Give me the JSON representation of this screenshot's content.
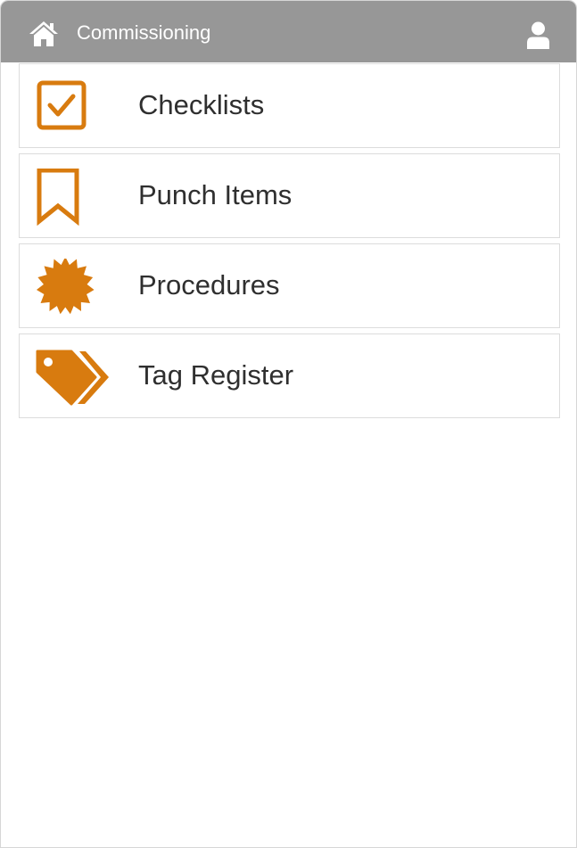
{
  "header": {
    "title": "Commissioning",
    "home_icon": "home-icon",
    "user_icon": "user-icon",
    "background_color": "#979797"
  },
  "menu": {
    "accent_color": "#d87b0f",
    "items": [
      {
        "label": "Checklists",
        "icon": "checkbox-checked-icon"
      },
      {
        "label": "Punch Items",
        "icon": "bookmark-icon"
      },
      {
        "label": "Procedures",
        "icon": "certificate-badge-icon"
      },
      {
        "label": "Tag Register",
        "icon": "tags-icon"
      }
    ]
  }
}
